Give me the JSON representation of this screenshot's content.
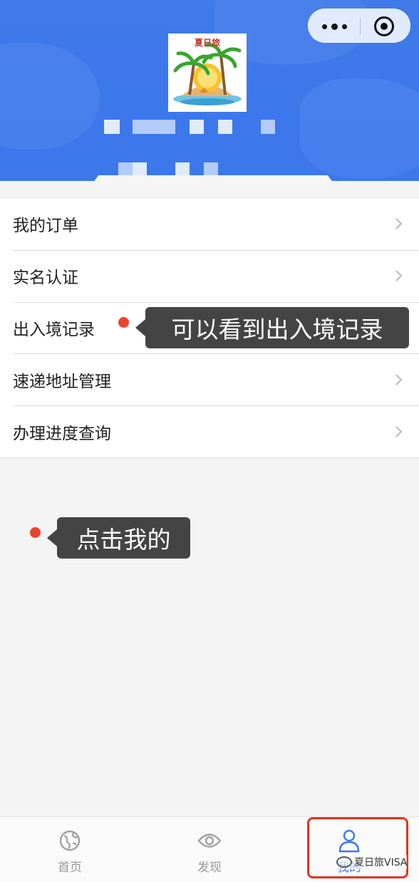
{
  "menu": {
    "items": [
      {
        "label": "我的订单"
      },
      {
        "label": "实名认证"
      },
      {
        "label": "出入境记录"
      },
      {
        "label": "速递地址管理"
      },
      {
        "label": "办理进度查询"
      }
    ]
  },
  "logo": {
    "title": "夏日旅"
  },
  "tooltips": {
    "records": "可以看到出入境记录",
    "mine": "点击我的"
  },
  "tabbar": {
    "items": [
      {
        "label": "首页",
        "icon": "globe-icon"
      },
      {
        "label": "发现",
        "icon": "eye-icon"
      },
      {
        "label": "我的",
        "icon": "user-icon",
        "active": true
      }
    ]
  },
  "watermark": "夏日旅VISA",
  "colors": {
    "header": "#3b78ec",
    "accent": "#3b78ec",
    "annotation": "#e8452f",
    "highlight": "#e0341f"
  }
}
